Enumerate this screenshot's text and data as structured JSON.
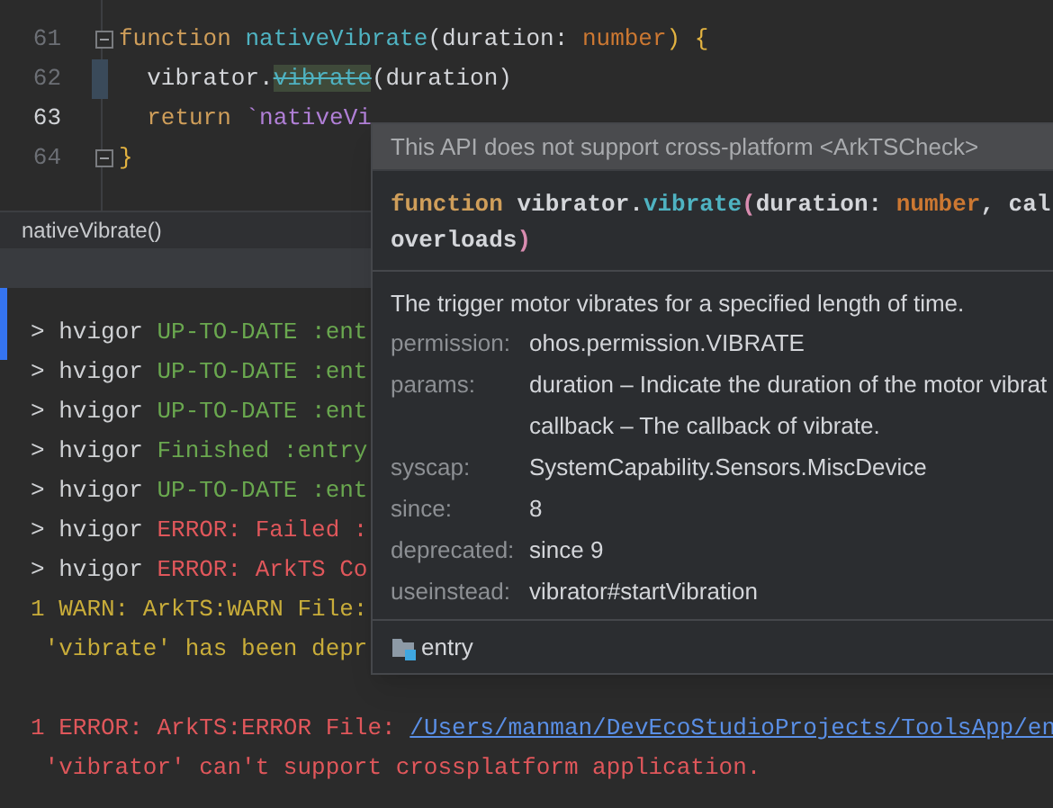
{
  "editor": {
    "lines": [
      {
        "number": "61",
        "current": false,
        "modified": false,
        "fold": true,
        "tokens": [
          {
            "text": "function ",
            "kind": "keyword"
          },
          {
            "text": "nativeVibrate",
            "kind": "function"
          },
          {
            "text": "(duration: ",
            "kind": "plain"
          },
          {
            "text": "number",
            "kind": "type"
          },
          {
            "text": ") {",
            "kind": "brace"
          }
        ]
      },
      {
        "number": "62",
        "current": false,
        "modified": true,
        "fold": false,
        "tokens": [
          {
            "text": "  vibrator.",
            "kind": "plain"
          },
          {
            "text": "vibrate",
            "kind": "deprecated"
          },
          {
            "text": "(duration)",
            "kind": "plain"
          }
        ]
      },
      {
        "number": "63",
        "current": true,
        "modified": false,
        "fold": false,
        "tokens": [
          {
            "text": "  return ",
            "kind": "keyword"
          },
          {
            "text": "`nativeVi",
            "kind": "string"
          }
        ]
      },
      {
        "number": "64",
        "current": false,
        "modified": false,
        "fold": true,
        "tokens": [
          {
            "text": "}",
            "kind": "brace"
          }
        ]
      }
    ],
    "breadcrumb": "nativeVibrate()"
  },
  "console": {
    "groups": [
      [
        {
          "tokens": [
            {
              "text": "> ",
              "kind": "prompt"
            },
            {
              "text": "hvigor ",
              "kind": "tool"
            },
            {
              "text": "UP-TO-DATE :ent",
              "kind": "ok"
            }
          ]
        },
        {
          "tokens": [
            {
              "text": "> ",
              "kind": "prompt"
            },
            {
              "text": "hvigor ",
              "kind": "tool"
            },
            {
              "text": "UP-TO-DATE :ent",
              "kind": "ok"
            }
          ]
        },
        {
          "tokens": [
            {
              "text": "> ",
              "kind": "prompt"
            },
            {
              "text": "hvigor ",
              "kind": "tool"
            },
            {
              "text": "UP-TO-DATE :ent",
              "kind": "ok"
            }
          ]
        },
        {
          "tokens": [
            {
              "text": "> ",
              "kind": "prompt"
            },
            {
              "text": "hvigor ",
              "kind": "tool"
            },
            {
              "text": "Finished :entry",
              "kind": "ok"
            }
          ]
        },
        {
          "tokens": [
            {
              "text": "> ",
              "kind": "prompt"
            },
            {
              "text": "hvigor ",
              "kind": "tool"
            },
            {
              "text": "UP-TO-DATE :ent",
              "kind": "ok"
            }
          ]
        },
        {
          "tokens": [
            {
              "text": "> ",
              "kind": "prompt"
            },
            {
              "text": "hvigor ",
              "kind": "tool"
            },
            {
              "text": "ERROR: Failed :",
              "kind": "error"
            }
          ]
        },
        {
          "tokens": [
            {
              "text": "> ",
              "kind": "prompt"
            },
            {
              "text": "hvigor ",
              "kind": "tool"
            },
            {
              "text": "ERROR: ArkTS Co",
              "kind": "error"
            }
          ]
        },
        {
          "tokens": [
            {
              "text": "1 WARN: ArkTS:WARN File:",
              "kind": "warn"
            }
          ]
        },
        {
          "tokens": [
            {
              "text": " 'vibrate' has been depr",
              "kind": "warn"
            }
          ]
        }
      ],
      [
        {
          "tokens": [
            {
              "text": "1 ERROR: ArkTS:ERROR File: ",
              "kind": "error"
            },
            {
              "text": "/Users/manman/DevEcoStudioProjects/ToolsApp/en",
              "kind": "link"
            }
          ]
        },
        {
          "tokens": [
            {
              "text": " 'vibrator' can't support crossplatform application.",
              "kind": "error"
            }
          ]
        }
      ]
    ]
  },
  "popup": {
    "warning": "This API does not support cross-platform <ArkTSCheck>",
    "signature": [
      [
        {
          "text": "function",
          "kind": "keyword"
        },
        {
          "text": " vibrator.",
          "kind": "plain"
        },
        {
          "text": "vibrate",
          "kind": "function"
        },
        {
          "text": "(",
          "kind": "paren"
        },
        {
          "text": "duration: ",
          "kind": "plain"
        },
        {
          "text": "number",
          "kind": "type"
        },
        {
          "text": ", cal",
          "kind": "plain"
        }
      ],
      [
        {
          "text": "overloads",
          "kind": "plain"
        },
        {
          "text": ")",
          "kind": "paren"
        }
      ]
    ],
    "description": "The trigger motor vibrates for a specified length of time.",
    "rows": [
      {
        "label": "permission:",
        "values": [
          "ohos.permission.VIBRATE"
        ]
      },
      {
        "label": "params:",
        "values": [
          "duration – Indicate the duration of the motor vibrat",
          "callback – The callback of vibrate."
        ]
      },
      {
        "label": "syscap:",
        "values": [
          "SystemCapability.Sensors.MiscDevice"
        ]
      },
      {
        "label": "since:",
        "values": [
          "8"
        ]
      },
      {
        "label": "deprecated:",
        "values": [
          "since 9"
        ]
      },
      {
        "label": "useinstead:",
        "values": [
          "vibrator#startVibration"
        ]
      }
    ],
    "module": "entry"
  }
}
